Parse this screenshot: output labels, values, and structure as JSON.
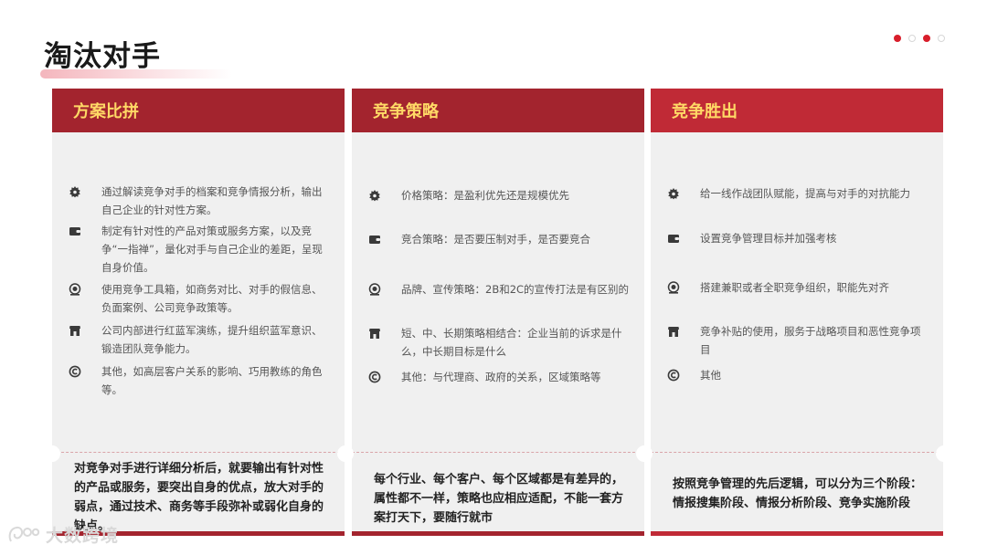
{
  "title": "淘汰对手",
  "pagination": {
    "count": 4,
    "active": [
      1,
      3
    ]
  },
  "cards": [
    {
      "header": "方案比拼",
      "header_color": "#a3242e",
      "bar_color": "#a3242e",
      "items": [
        {
          "icon": "gear-badge-icon",
          "text": "通过解读竞争对手的档案和竞争情报分析，输出自己企业的针对性方案。"
        },
        {
          "icon": "wallet-icon",
          "text": "制定有针对性的产品对策或服务方案，以及竞争“一指禅”，量化对手与自己企业的差距，呈现自身价值。"
        },
        {
          "icon": "target-icon",
          "text": "使用竞争工具箱，如商务对比、对手的假信息、负面案例、公司竞争政策等。"
        },
        {
          "icon": "shop-icon",
          "text": "公司内部进行红蓝军演练，提升组织蓝军意识、锻造团队竞争能力。"
        },
        {
          "icon": "copyright-icon",
          "text": "其他，如高层客户关系的影响、巧用教练的角色等。"
        }
      ],
      "footer": "对竞争对手进行详细分析后，就要输出有针对性的产品或服务，要突出自身的优点，放大对手的弱点，通过技术、商务等手段弥补或弱化自身的缺点。"
    },
    {
      "header": "竞争策略",
      "header_color": "#a3242e",
      "bar_color": "#a3242e",
      "items": [
        {
          "icon": "gear-badge-icon",
          "text": "价格策略：是盈利优先还是规模优先"
        },
        {
          "icon": "wallet-icon",
          "text": "竞合策略：是否要压制对手，是否要竞合"
        },
        {
          "icon": "target-icon",
          "text": "品牌、宣传策略：2B和2C的宣传打法是有区别的"
        },
        {
          "icon": "shop-icon",
          "text": "短、中、长期策略相结合：企业当前的诉求是什么，中长期目标是什么"
        },
        {
          "icon": "copyright-icon",
          "text": "其他：与代理商、政府的关系，区域策略等"
        }
      ],
      "footer": "每个行业、每个客户、每个区域都是有差异的，属性都不一样，策略也应相应适配，不能一套方案打天下，要随行就市"
    },
    {
      "header": "竞争胜出",
      "header_color": "#c02a36",
      "bar_color": "#c02a36",
      "items": [
        {
          "icon": "gear-badge-icon",
          "text": "给一线作战团队赋能，提高与对手的对抗能力"
        },
        {
          "icon": "wallet-icon",
          "text": "设置竞争管理目标并加强考核"
        },
        {
          "icon": "target-icon",
          "text": "搭建兼职或者全职竞争组织，职能先对齐"
        },
        {
          "icon": "shop-icon",
          "text": "竞争补贴的使用，服务于战略项目和恶性竞争项目"
        },
        {
          "icon": "copyright-icon",
          "text": "其他"
        }
      ],
      "footer": "按照竞争管理的先后逻辑，可以分为三个阶段：情报搜集阶段、情报分析阶段、竞争实施阶段"
    }
  ],
  "watermark": {
    "text": "大数跨境"
  }
}
